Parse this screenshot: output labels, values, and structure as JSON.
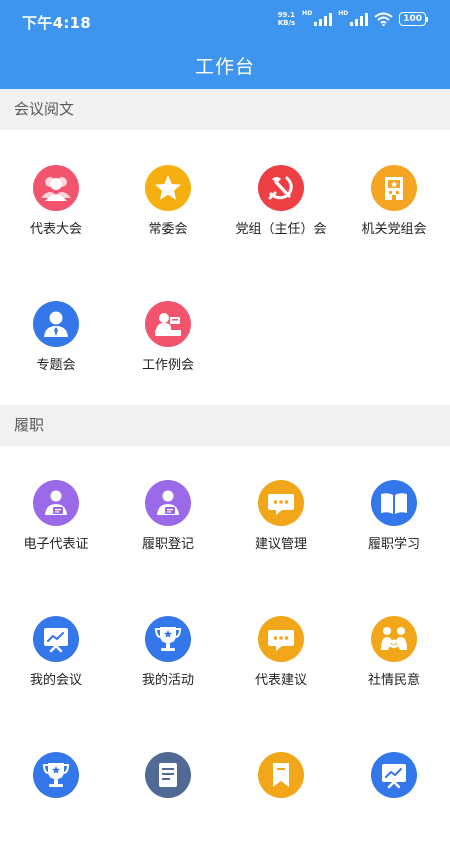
{
  "status_bar": {
    "time": "下午4:18",
    "net_speed_value": "99.1",
    "net_speed_unit": "KB/s",
    "hd1": "HD",
    "hd2": "HD",
    "battery": "100"
  },
  "header": {
    "title": "工作台"
  },
  "sections": [
    {
      "title": "会议阅文",
      "items": [
        {
          "label": "代表大会",
          "icon": "people-icon",
          "color": "#f2546d"
        },
        {
          "label": "常委会",
          "icon": "star-icon",
          "color": "#f5b00f"
        },
        {
          "label": "党组（主任）会",
          "icon": "party-emblem-icon",
          "color": "#ee4044"
        },
        {
          "label": "机关党组会",
          "icon": "building-icon",
          "color": "#f5a524"
        },
        {
          "label": "专题会",
          "icon": "person-tie-icon",
          "color": "#3377ea"
        },
        {
          "label": "工作例会",
          "icon": "presenter-icon",
          "color": "#f2546d"
        }
      ]
    },
    {
      "title": "履职",
      "items": [
        {
          "label": "电子代表证",
          "icon": "id-card-person-icon",
          "color": "#9a6ae8"
        },
        {
          "label": "履职登记",
          "icon": "register-person-icon",
          "color": "#9a6ae8"
        },
        {
          "label": "建议管理",
          "icon": "chat-bubble-icon",
          "color": "#f2a71a"
        },
        {
          "label": "履职学习",
          "icon": "open-book-icon",
          "color": "#3377ea"
        },
        {
          "label": "我的会议",
          "icon": "screen-chart-icon",
          "color": "#3377ea"
        },
        {
          "label": "我的活动",
          "icon": "trophy-icon",
          "color": "#3377ea"
        },
        {
          "label": "代表建议",
          "icon": "chat-bubble-icon",
          "color": "#f2a71a"
        },
        {
          "label": "社情民意",
          "icon": "family-icon",
          "color": "#f2a71a"
        },
        {
          "icon": "trophy-icon",
          "color": "#3377ea"
        },
        {
          "icon": "document-icon",
          "color": "#516a95"
        },
        {
          "icon": "bookmark-icon",
          "color": "#f2a71a"
        },
        {
          "icon": "screen-chart-icon",
          "color": "#3377ea"
        }
      ]
    }
  ]
}
